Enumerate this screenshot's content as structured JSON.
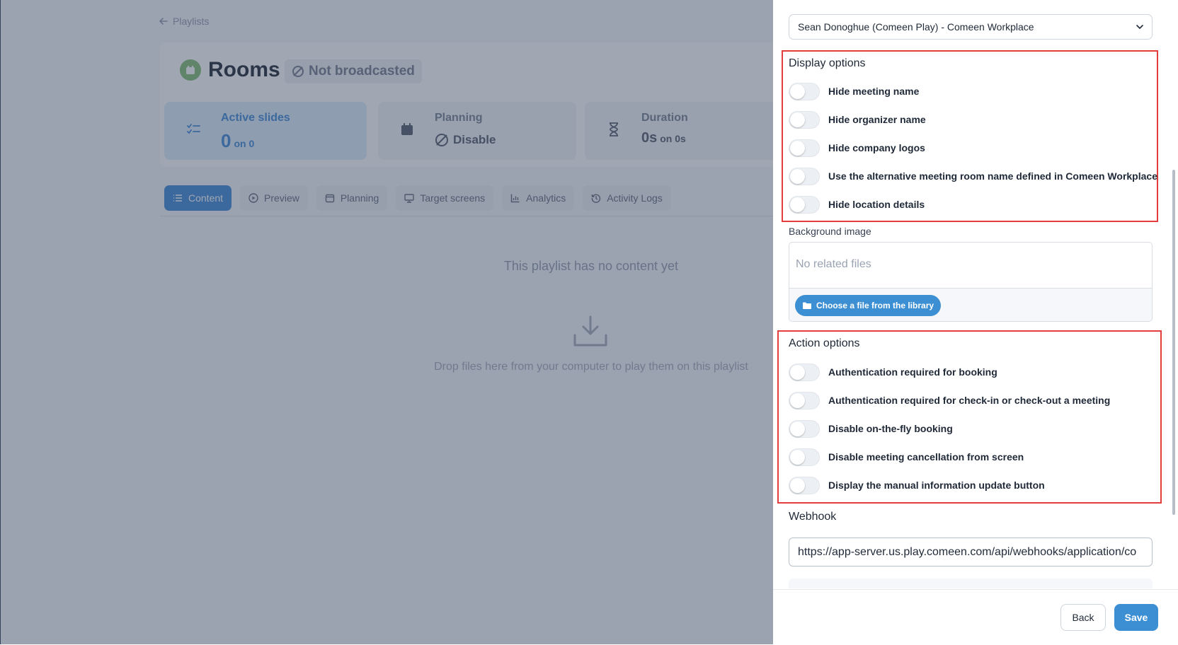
{
  "background": {
    "breadcrumb": "Playlists",
    "playlist_title": "Rooms",
    "broadcast_status": "Not broadcasted",
    "stats": [
      {
        "label": "Active slides",
        "value": "0",
        "sub": "on 0",
        "icon": "list-check-icon"
      },
      {
        "label": "Planning",
        "value": "Disable",
        "sub": "",
        "icon": "calendar-icon"
      },
      {
        "label": "Duration",
        "value": "0s",
        "sub": "on 0s",
        "icon": "hourglass-icon"
      }
    ],
    "tabs": [
      {
        "label": "Content",
        "icon": "list-icon",
        "active": true
      },
      {
        "label": "Preview",
        "icon": "play-circle-icon",
        "active": false
      },
      {
        "label": "Planning",
        "icon": "calendar-icon",
        "active": false
      },
      {
        "label": "Target screens",
        "icon": "monitor-icon",
        "active": false
      },
      {
        "label": "Analytics",
        "icon": "chart-icon",
        "active": false
      },
      {
        "label": "Activity Logs",
        "icon": "history-icon",
        "active": false
      }
    ],
    "empty_message": "This playlist has no content yet",
    "drop_message": "Drop files here from your computer to play them on this playlist"
  },
  "panel": {
    "account_select": "Sean Donoghue (Comeen Play) - Comeen Workplace",
    "display_options": {
      "title": "Display options",
      "items": [
        "Hide meeting name",
        "Hide organizer name",
        "Hide company logos",
        "Use the alternative meeting room name defined in Comeen Workplace",
        "Hide location details"
      ]
    },
    "background_image": {
      "label": "Background image",
      "empty_text": "No related files",
      "choose_button": "Choose a file from the library"
    },
    "action_options": {
      "title": "Action options",
      "items": [
        "Authentication required for booking",
        "Authentication required for check-in or check-out a meeting",
        "Disable on-the-fly booking",
        "Disable meeting cancellation from screen",
        "Display the manual information update button"
      ]
    },
    "webhook": {
      "label": "Webhook",
      "value": "https://app-server.us.play.comeen.com/api/webhooks/application/co"
    },
    "footer": {
      "back_label": "Back",
      "save_label": "Save"
    }
  },
  "colors": {
    "accent": "#3d8fd4",
    "highlight_box": "#e23c3c",
    "overlay": "#2c3954"
  }
}
